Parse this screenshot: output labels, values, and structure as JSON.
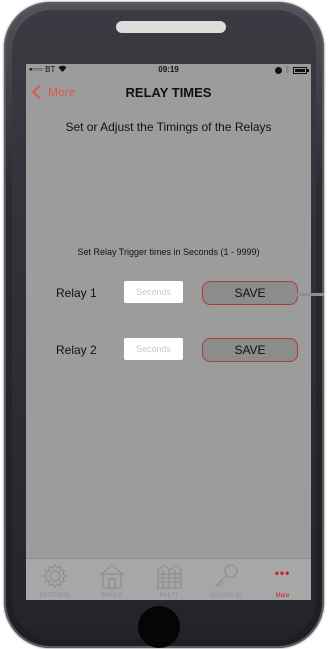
{
  "status_bar": {
    "carrier": "BT",
    "time": "09:19"
  },
  "nav": {
    "back_label": "More",
    "title": "RELAY TIMES"
  },
  "subtitle": "Set or Adjust the Timings of the Relays",
  "instructions": "Set Relay Trigger times in Seconds (1 -  9999)",
  "relays": [
    {
      "label": "Relay 1",
      "input_placeholder": "Seconds",
      "input_value": "",
      "save_label": "SAVE"
    },
    {
      "label": "Relay 2",
      "input_placeholder": "Seconds",
      "input_value": "",
      "save_label": "SAVE"
    }
  ],
  "tabs": [
    {
      "label": "SETTINGS",
      "icon": "gear-icon",
      "active": false
    },
    {
      "label": "SINGLE",
      "icon": "house-icon",
      "active": false
    },
    {
      "label": "MULTI",
      "icon": "building-icon",
      "active": false
    },
    {
      "label": "CALLER ID",
      "icon": "key-icon",
      "active": false
    },
    {
      "label": "More",
      "icon": "more-dots-icon",
      "active": true
    }
  ],
  "colors": {
    "accent": "#d9594c",
    "active_tab": "#cc1f1f",
    "screen_overlay": "#9c9c9c",
    "save_border": "#b33a37"
  }
}
